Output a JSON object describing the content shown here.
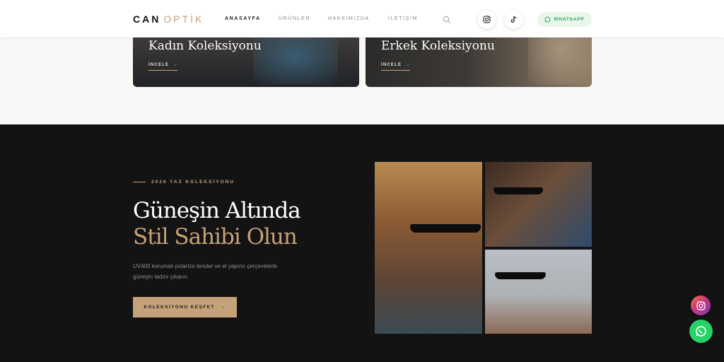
{
  "header": {
    "logo_part1": "CAN",
    "logo_part2": "OPTİK",
    "nav": [
      "ANASAYFA",
      "ÜRÜNLER",
      "HAKKIMIZDA",
      "İLETİŞİM"
    ],
    "whatsapp_label": "WHATSAPP"
  },
  "collections": [
    {
      "title": "Kadın Koleksiyonu",
      "link": "İNCELE"
    },
    {
      "title": "Erkek Koleksiyonu",
      "link": "İNCELE"
    }
  ],
  "hero": {
    "eyebrow": "2026 YAZ KOLEKSİYONU",
    "title_line1": "Güneşin Altında",
    "title_line2": "Stil Sahibi Olun",
    "description": "UV400 korumalı polarize lensler ve el yapımı çerçevelerle güneşin tadını çıkarın.",
    "cta": "KOLEKSİYONU KEŞFET"
  },
  "colors": {
    "accent": "#c6a27a",
    "dark_bg": "#131313",
    "light_bg": "#f9f8f6",
    "whatsapp": "#25d366"
  },
  "icons": [
    "search-icon",
    "instagram-icon",
    "tiktok-icon",
    "whatsapp-icon",
    "arrow-right-icon"
  ]
}
